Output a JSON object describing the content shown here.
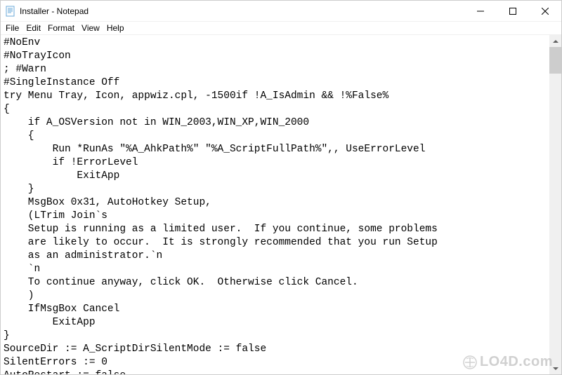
{
  "window": {
    "title": "Installer - Notepad"
  },
  "menu": {
    "items": [
      "File",
      "Edit",
      "Format",
      "View",
      "Help"
    ]
  },
  "editor": {
    "content": "#NoEnv\n#NoTrayIcon\n; #Warn\n#SingleInstance Off\ntry Menu Tray, Icon, appwiz.cpl, -1500if !A_IsAdmin && !%False%\n{\n    if A_OSVersion not in WIN_2003,WIN_XP,WIN_2000\n    {\n        Run *RunAs \"%A_AhkPath%\" \"%A_ScriptFullPath%\",, UseErrorLevel\n        if !ErrorLevel\n            ExitApp\n    }\n    MsgBox 0x31, AutoHotkey Setup,\n    (LTrim Join`s\n    Setup is running as a limited user.  If you continue, some problems\n    are likely to occur.  It is strongly recommended that you run Setup\n    as an administrator.`n\n    `n\n    To continue anyway, click OK.  Otherwise click Cancel.\n    )\n    IfMsgBox Cancel\n        ExitApp\n}\nSourceDir := A_ScriptDirSilentMode := false\nSilentErrors := 0\nAutoRestart := false"
  },
  "watermark": {
    "text": "LO4D.com"
  }
}
